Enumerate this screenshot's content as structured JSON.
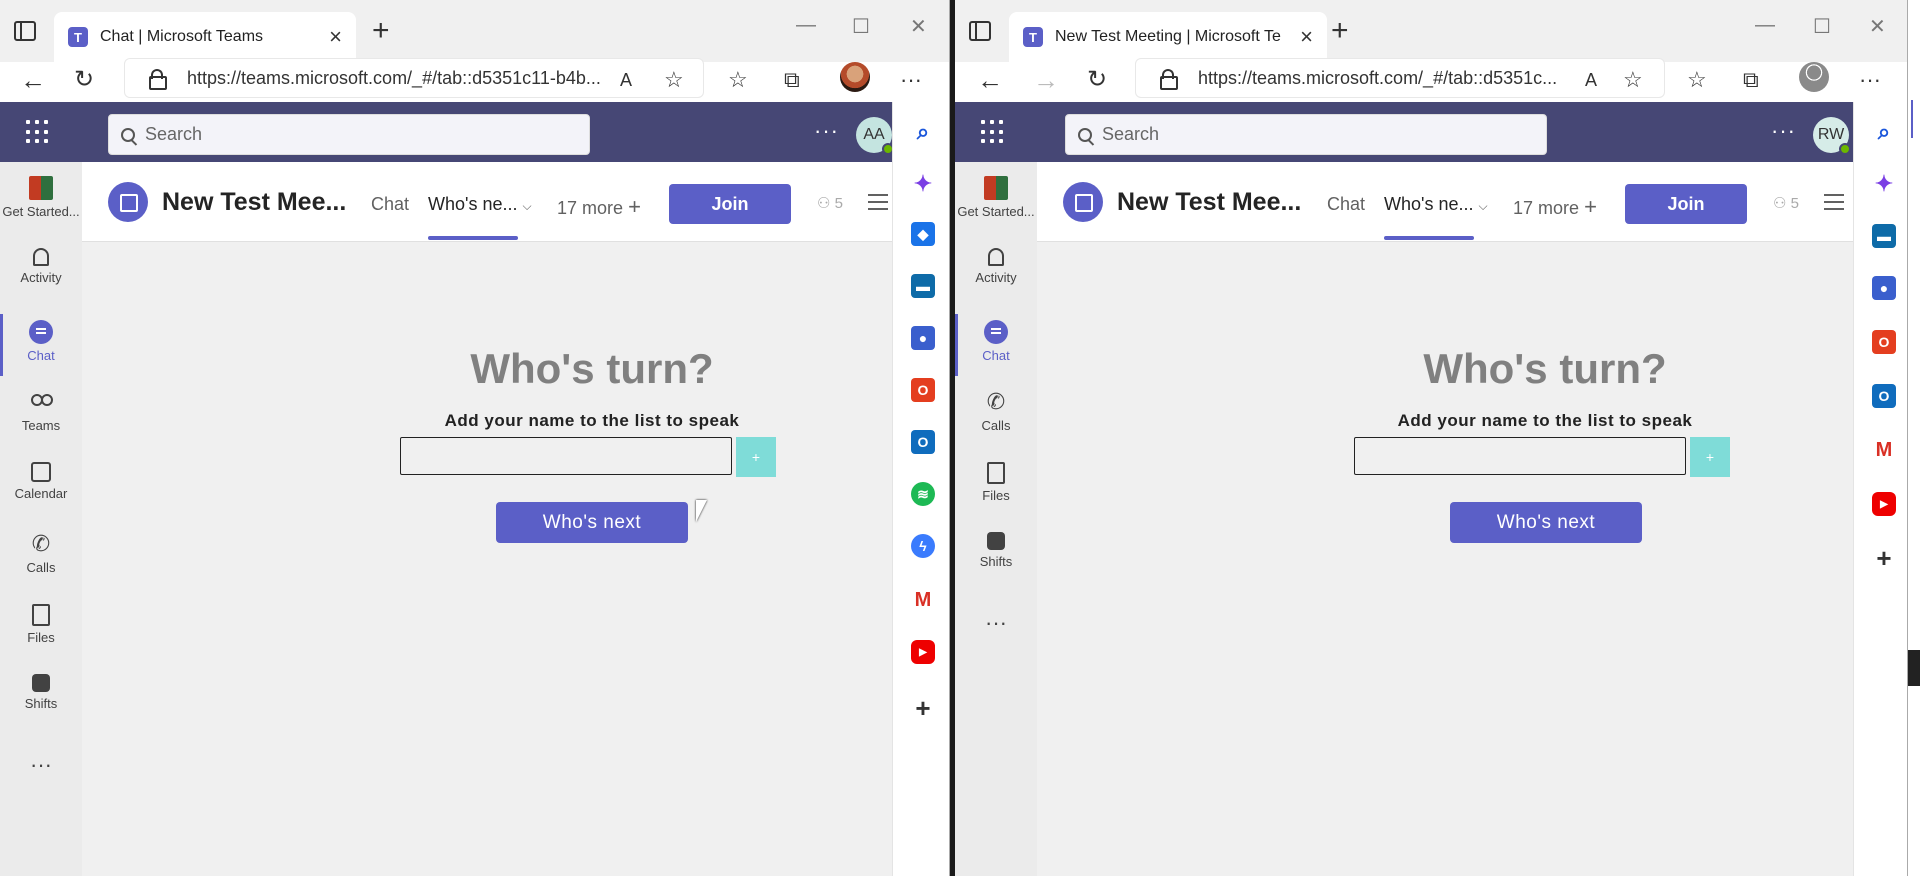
{
  "left": {
    "tab_title": "Chat | Microsoft Teams",
    "url": "https://teams.microsoft.com/_#/tab::d5351c11-b4b...",
    "search_placeholder": "Search",
    "avatar_initials": "AA",
    "meeting_title": "New Test Mee...",
    "tabs": {
      "chat": "Chat",
      "whos_next": "Who's ne...",
      "more": "17 more"
    },
    "join_label": "Join",
    "participant_count": "5",
    "rail": [
      "Get Started...",
      "Activity",
      "Chat",
      "Teams",
      "Calendar",
      "Calls",
      "Files",
      "Shifts"
    ],
    "widget": {
      "heading": "Who's turn?",
      "subheading": "Add your name to the list to speak",
      "add_label": "+",
      "next_label": "Who's next"
    }
  },
  "right": {
    "tab_title": "New Test Meeting | Microsoft Te",
    "url": "https://teams.microsoft.com/_#/tab::d5351c...",
    "search_placeholder": "Search",
    "avatar_initials": "RW",
    "meeting_title": "New Test Mee...",
    "tabs": {
      "chat": "Chat",
      "whos_next": "Who's ne...",
      "more": "17 more"
    },
    "join_label": "Join",
    "participant_count": "5",
    "rail": [
      "Get Started...",
      "Activity",
      "Chat",
      "Calls",
      "Files",
      "Shifts"
    ],
    "widget": {
      "heading": "Who's turn?",
      "subheading": "Add your name to the list to speak",
      "add_label": "+",
      "next_label": "Who's next"
    }
  },
  "colors": {
    "teams_purple": "#5b5fc7",
    "header": "#464775",
    "add_button": "#7fdcd8"
  }
}
